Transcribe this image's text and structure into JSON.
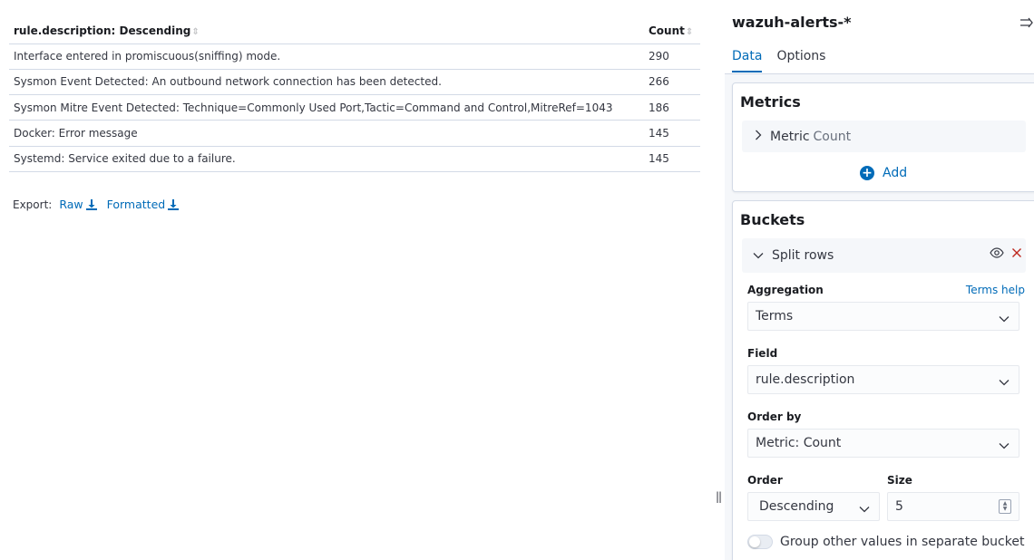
{
  "table": {
    "columns": [
      {
        "label": "rule.description: Descending"
      },
      {
        "label": "Count"
      }
    ],
    "rows": [
      {
        "description": "Interface entered in promiscuous(sniffing) mode.",
        "count": "290"
      },
      {
        "description": "Sysmon Event Detected: An outbound network connection has been detected.",
        "count": "266"
      },
      {
        "description": "Sysmon Mitre Event Detected: Technique=Commonly Used Port,Tactic=Command and Control,MitreRef=1043",
        "count": "186"
      },
      {
        "description": "Docker: Error message",
        "count": "145"
      },
      {
        "description": "Systemd: Service exited due to a failure.",
        "count": "145"
      }
    ]
  },
  "export": {
    "label": "Export:",
    "raw": "Raw",
    "formatted": "Formatted"
  },
  "resize_handle": "||",
  "sidebar": {
    "index_pattern": "wazuh-alerts-*",
    "tabs": [
      "Data",
      "Options"
    ],
    "metrics": {
      "title": "Metrics",
      "metric_label": "Metric",
      "metric_value": "Count",
      "add_label": "Add"
    },
    "buckets": {
      "title": "Buckets",
      "split_label": "Split rows",
      "aggregation_label": "Aggregation",
      "aggregation_help": "Terms help",
      "aggregation_value": "Terms",
      "field_label": "Field",
      "field_value": "rule.description",
      "order_by_label": "Order by",
      "order_by_value": "Metric: Count",
      "order_label": "Order",
      "order_value": "Descending",
      "size_label": "Size",
      "size_value": "5",
      "group_other_label": "Group other values in separate bucket"
    }
  },
  "colors": {
    "accent": "#006bb8",
    "danger": "#bd271e",
    "sidebar_bg": "#f5f7fa"
  }
}
